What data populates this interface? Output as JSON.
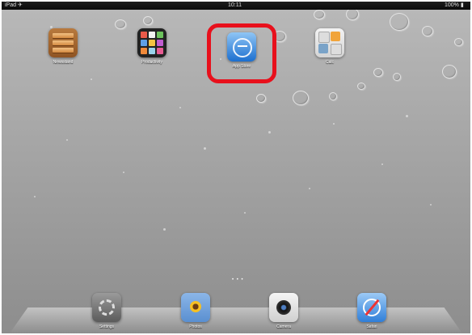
{
  "status_bar": {
    "carrier": "iPad ✈",
    "time": "10:11",
    "battery": "100% ▮"
  },
  "home_apps": [
    {
      "id": "newsstand",
      "label": "Newsstand",
      "icon": "newsstand-icon"
    },
    {
      "id": "grid",
      "label": "Productivity",
      "icon": "app-grid-icon"
    },
    {
      "id": "appstore",
      "label": "App Store",
      "icon": "app-store-icon",
      "highlighted": true
    },
    {
      "id": "calc",
      "label": "Calc",
      "icon": "calculator-icon"
    }
  ],
  "dock_apps": [
    {
      "id": "settings",
      "label": "Settings",
      "icon": "gear-icon"
    },
    {
      "id": "photos",
      "label": "Photos",
      "icon": "sunflower-icon"
    },
    {
      "id": "camera",
      "label": "Camera",
      "icon": "camera-lens-icon"
    },
    {
      "id": "safari",
      "label": "Safari",
      "icon": "compass-icon"
    }
  ],
  "page_indicator": "• • •",
  "colors": {
    "highlight": "#e8101c",
    "wallpaper": "#a9a9a9"
  }
}
